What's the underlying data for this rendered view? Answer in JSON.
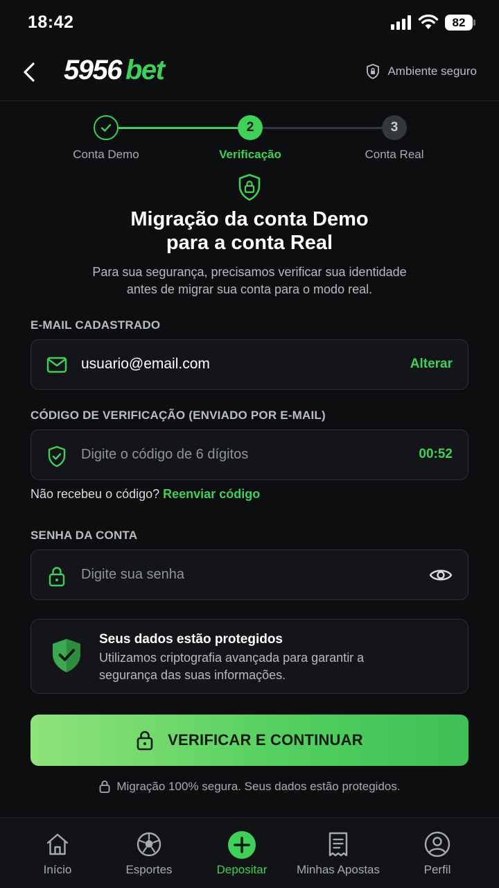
{
  "status_bar": {
    "time": "18:42",
    "battery": "82"
  },
  "header": {
    "logo_number": "5956",
    "logo_suffix": "bet",
    "secure_label": "Ambiente seguro"
  },
  "stepper": {
    "steps": [
      {
        "number": "1",
        "label": "Conta Demo",
        "state": "done"
      },
      {
        "number": "2",
        "label": "Verificação",
        "state": "active"
      },
      {
        "number": "3",
        "label": "Conta Real",
        "state": "pending"
      }
    ]
  },
  "main": {
    "title_line1": "Migração da conta Demo",
    "title_line2": "para a conta Real",
    "subtitle_line1": "Para sua segurança, precisamos verificar sua identidade",
    "subtitle_line2": "antes de migrar sua conta para o modo real."
  },
  "email": {
    "label": "E-MAIL CADASTRADO",
    "value": "usuario@email.com",
    "action": "Alterar"
  },
  "code": {
    "label": "CÓDIGO DE VERIFICAÇÃO (ENVIADO POR E-MAIL)",
    "placeholder": "Digite o código de 6 dígitos",
    "timer": "00:52",
    "resend_prompt": "Não recebeu o código?",
    "resend_link": "Reenviar código"
  },
  "password": {
    "label": "SENHA DA CONTA",
    "placeholder": "Digite sua senha"
  },
  "protection": {
    "title": "Seus dados estão protegidos",
    "desc_line1": "Utilizamos criptografia avançada para garantir a",
    "desc_line2": "segurança das suas informações."
  },
  "cta": {
    "label": "VERIFICAR E CONTINUAR"
  },
  "footnote": "Migração 100% segura. Seus dados estão protegidos.",
  "tabbar": {
    "items": [
      {
        "label": "Início",
        "icon": "home-icon"
      },
      {
        "label": "Esportes",
        "icon": "soccer-ball-icon"
      },
      {
        "label": "Depositar",
        "icon": "plus-circle-icon",
        "active": true
      },
      {
        "label": "Minhas Apostas",
        "icon": "receipt-icon"
      },
      {
        "label": "Perfil",
        "icon": "user-circle-icon"
      }
    ]
  },
  "colors": {
    "accent": "#3fd05a",
    "background": "#0d0e10",
    "card": "#141518",
    "muted": "#a7abb1"
  }
}
